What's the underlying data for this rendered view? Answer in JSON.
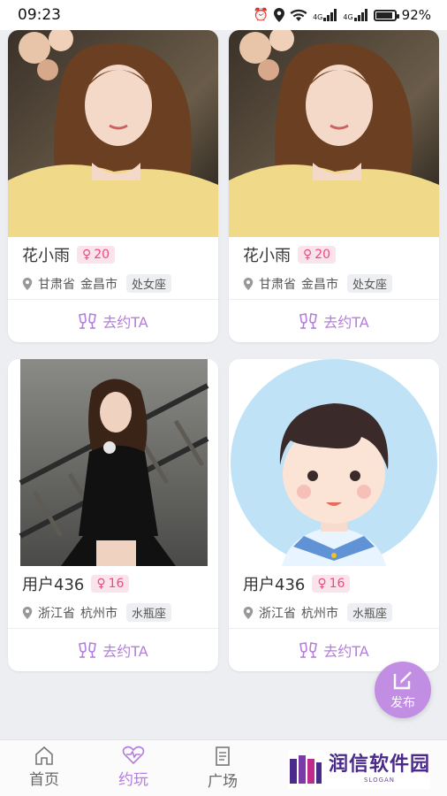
{
  "status_bar": {
    "time": "09:23",
    "battery": "92%",
    "battery_level": 0.92,
    "net_label_1": "4G",
    "net_label_2": "4G"
  },
  "cards": [
    {
      "name": "花小雨",
      "age": "20",
      "province": "甘肃省",
      "city": "金昌市",
      "zodiac": "处女座",
      "action": "去约TA",
      "photo": "girl-in-yellow-sweater-photo"
    },
    {
      "name": "花小雨",
      "age": "20",
      "province": "甘肃省",
      "city": "金昌市",
      "zodiac": "处女座",
      "action": "去约TA",
      "photo": "girl-in-yellow-sweater-photo"
    },
    {
      "name": "用户436",
      "age": "16",
      "province": "浙江省",
      "city": "杭州市",
      "zodiac": "水瓶座",
      "action": "去约TA",
      "photo": "woman-on-railway-photo"
    },
    {
      "name": "用户436",
      "age": "16",
      "province": "浙江省",
      "city": "杭州市",
      "zodiac": "水瓶座",
      "action": "去约TA",
      "photo": "cartoon-boy-avatar"
    }
  ],
  "fab": {
    "label": "发布"
  },
  "bottom_nav": {
    "items": [
      {
        "label": "首页",
        "icon": "home-icon"
      },
      {
        "label": "约玩",
        "icon": "heart-pulse-icon",
        "active": true
      },
      {
        "label": "广场",
        "icon": "note-icon"
      }
    ]
  },
  "watermark": {
    "title": "润信软件园",
    "sub": "SLOGAN"
  },
  "colors": {
    "accent": "#b37ddc",
    "badge_bg": "#fbe3ec",
    "badge_text": "#e94b84",
    "fab": "#c18ee4"
  }
}
